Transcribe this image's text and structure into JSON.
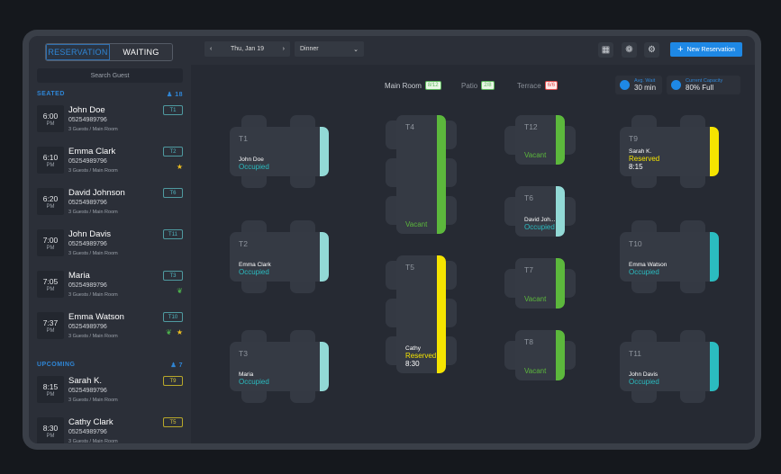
{
  "sidebar": {
    "tabs": [
      "RESERVATION",
      "WAITING"
    ],
    "search_placeholder": "Search Guest",
    "seated": {
      "label": "SEATED",
      "count": "18"
    },
    "upcoming": {
      "label": "UPCOMING",
      "count": "7"
    },
    "seated_items": [
      {
        "time": "6:00",
        "ampm": "PM",
        "name": "John Doe",
        "phone": "05254989796",
        "guests": "3 Guests  / Main Room",
        "table": "T1",
        "icons": []
      },
      {
        "time": "6:10",
        "ampm": "PM",
        "name": "Emma Clark",
        "phone": "05254989796",
        "guests": "3 Guests  / Main Room",
        "table": "T2",
        "icons": [
          "star"
        ]
      },
      {
        "time": "6:20",
        "ampm": "PM",
        "name": "David Johnson",
        "phone": "05254989796",
        "guests": "3 Guests  / Main Room",
        "table": "T6",
        "icons": []
      },
      {
        "time": "7:00",
        "ampm": "PM",
        "name": "John Davis",
        "phone": "05254989796",
        "guests": "3 Guests  / Main Room",
        "table": "T11",
        "icons": []
      },
      {
        "time": "7:05",
        "ampm": "PM",
        "name": "Maria",
        "phone": "05254989796",
        "guests": "3 Guests  / Main Room",
        "table": "T3",
        "icons": [
          "leaf"
        ]
      },
      {
        "time": "7:37",
        "ampm": "PM",
        "name": "Emma Watson",
        "phone": "05254989796",
        "guests": "3 Guests  / Main Room",
        "table": "T10",
        "icons": [
          "leaf",
          "star"
        ]
      }
    ],
    "upcoming_items": [
      {
        "time": "8:15",
        "ampm": "PM",
        "name": "Sarah K.",
        "phone": "05254989796",
        "guests": "3 Guests  / Main Room",
        "table": "T9",
        "icons": []
      },
      {
        "time": "8:30",
        "ampm": "PM",
        "name": "Cathy Clark",
        "phone": "05254989796",
        "guests": "3 Guests  / Main Room",
        "table": "T5",
        "icons": []
      }
    ]
  },
  "topbar": {
    "date": "Thu, Jan 19",
    "service": "Dinner",
    "new_reservation": "New Reservation"
  },
  "rooms": [
    {
      "name": "Main Room",
      "count": "8/12",
      "state": "ok"
    },
    {
      "name": "Patio",
      "count": "2/8",
      "state": "ok"
    },
    {
      "name": "Terrace",
      "count": "6/6",
      "state": "full"
    }
  ],
  "stats": {
    "wait_label": "Avg. Wait",
    "wait_value": "30 min",
    "capacity_label": "Current Capacity",
    "capacity_value": "80% Full"
  },
  "colors": {
    "occupied": "#2bbcc0",
    "vacant": "#5cb83c",
    "reserved": "#f5e400",
    "accent": "#1e88e5"
  },
  "tables": [
    {
      "id": "T1",
      "status": "Occupied",
      "guest": "John Doe",
      "bar": "#92d9d6"
    },
    {
      "id": "T2",
      "status": "Occupied",
      "guest": "Emma Clark",
      "bar": "#92d9d6"
    },
    {
      "id": "T3",
      "status": "Occupied",
      "guest": "Maria",
      "bar": "#92d9d6"
    },
    {
      "id": "T4",
      "status": "Vacant",
      "bar": "#5cb83c"
    },
    {
      "id": "T5",
      "status": "Reserved",
      "guest": "Cathy",
      "time": "8:30",
      "bar": "#f5e400"
    },
    {
      "id": "T12",
      "status": "Vacant",
      "bar": "#5cb83c"
    },
    {
      "id": "T6",
      "status": "Occupied",
      "guest": "David Joh...",
      "bar": "#92d9d6"
    },
    {
      "id": "T7",
      "status": "Vacant",
      "bar": "#5cb83c"
    },
    {
      "id": "T8",
      "status": "Vacant",
      "bar": "#5cb83c"
    },
    {
      "id": "T9",
      "status": "Reserved",
      "guest": "Sarah K.",
      "time": "8:15",
      "bar": "#f5e400"
    },
    {
      "id": "T10",
      "status": "Occupied",
      "guest": "Emma Watson",
      "bar": "#2bbcc0"
    },
    {
      "id": "T11",
      "status": "Occupied",
      "guest": "John Davis",
      "bar": "#2bbcc0"
    }
  ]
}
